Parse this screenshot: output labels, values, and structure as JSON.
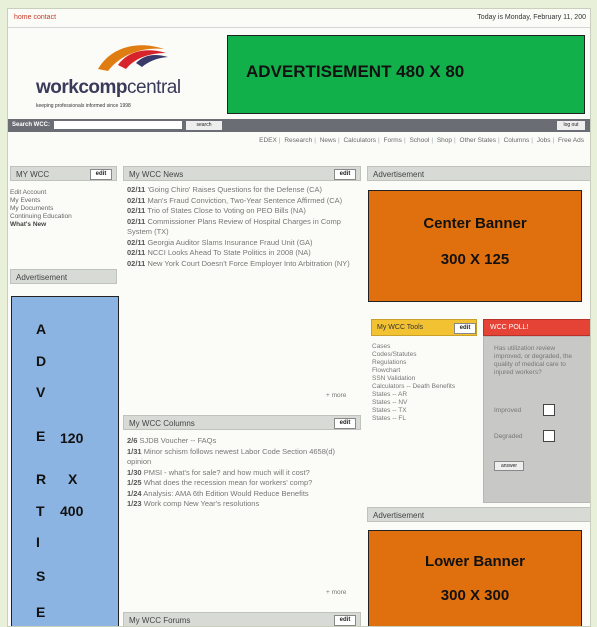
{
  "topbar": {
    "links": "home contact",
    "date": "Today is Monday, February 11, 200"
  },
  "logo": {
    "name_bold": "workcomp",
    "name_light": "central",
    "tagline": "keeping professionals informed since 1998"
  },
  "ads": {
    "top": "ADVERTISEMENT  480 X 80",
    "left_letters": [
      "A",
      "D",
      "V",
      "E",
      "R",
      "T",
      "I",
      "S",
      "E"
    ],
    "left_size": [
      "120",
      "X",
      "400"
    ],
    "center_line1": "Center Banner",
    "center_line2": "300 X 125",
    "lower_line1": "Lower Banner",
    "lower_line2": "300 X 300"
  },
  "search": {
    "label": "Search WCC:",
    "button": "search",
    "logout": "log out"
  },
  "nav": [
    "EDEX",
    "Research",
    "News",
    "Calculators",
    "Forms",
    "School",
    "Shop",
    "Other States",
    "Columns",
    "Jobs",
    "Free Ads"
  ],
  "my_wcc": {
    "title": "MY WCC",
    "edit": "edit",
    "items": [
      "Edit Account",
      "My Events",
      "My Documents",
      "Continuing Education",
      "What's New"
    ]
  },
  "left_advertisement_label": "Advertisement",
  "news": {
    "title": "My WCC News",
    "edit": "edit",
    "items": [
      {
        "date": "02/11",
        "text": "'Going Chiro' Raises Questions for the Defense (CA)"
      },
      {
        "date": "02/11",
        "text": "Man's Fraud Conviction, Two-Year Sentence Affirmed (CA)"
      },
      {
        "date": "02/11",
        "text": "Trio of States Close to Voting on PEO Bills (NA)"
      },
      {
        "date": "02/11",
        "text": "Commissioner Plans Review of Hospital Charges in Comp System (TX)"
      },
      {
        "date": "02/11",
        "text": "Georgia Auditor Slams Insurance Fraud Unit (GA)"
      },
      {
        "date": "02/11",
        "text": "NCCI Looks Ahead To State Politics in 2008 (NA)"
      },
      {
        "date": "02/11",
        "text": "New York Court Doesn't Force Employer Into Arbitration (NY)"
      }
    ],
    "more": "+ more"
  },
  "columns": {
    "title": "My WCC Columns",
    "edit": "edit",
    "items": [
      {
        "date": "2/6",
        "text": "SJDB Voucher -- FAQs"
      },
      {
        "date": "1/31",
        "text": "Minor schism follows newest Labor Code Section 4658(d) opinion"
      },
      {
        "date": "1/30",
        "text": "PMSI - what's for sale? and how much will it cost?"
      },
      {
        "date": "1/25",
        "text": "What does the recession mean for workers' comp?"
      },
      {
        "date": "1/24",
        "text": "Analysis: AMA 6th Edition Would Reduce Benefits"
      },
      {
        "date": "1/23",
        "text": "Work comp New Year's resolutions"
      }
    ],
    "more": "+ more"
  },
  "forums": {
    "title": "My WCC Forums",
    "edit": "edit"
  },
  "right_ad_labels": {
    "upper": "Advertisement",
    "lower": "Advertisement"
  },
  "tools": {
    "title": "My WCC Tools",
    "edit": "edit",
    "items": [
      "Cases",
      "Codes/Statutes",
      "Regulations",
      "Flowchart",
      "SSN Validation",
      "Calculators -- Death Benefits",
      "States -- AR",
      "States -- NV",
      "States -- TX",
      "States -- FL"
    ]
  },
  "poll": {
    "title": "WCC POLL!",
    "question": "Has utilization review improved, or degraded, the quality of medical care to injured workers?",
    "options": [
      "Improved",
      "Degraded"
    ],
    "answer_button": "answer"
  },
  "colors": {
    "green_ad": "#12b04a",
    "blue_ad": "#8cb4e2",
    "orange_ad": "#e0700e",
    "tools_yellow": "#f2c233",
    "poll_red": "#e54336"
  }
}
